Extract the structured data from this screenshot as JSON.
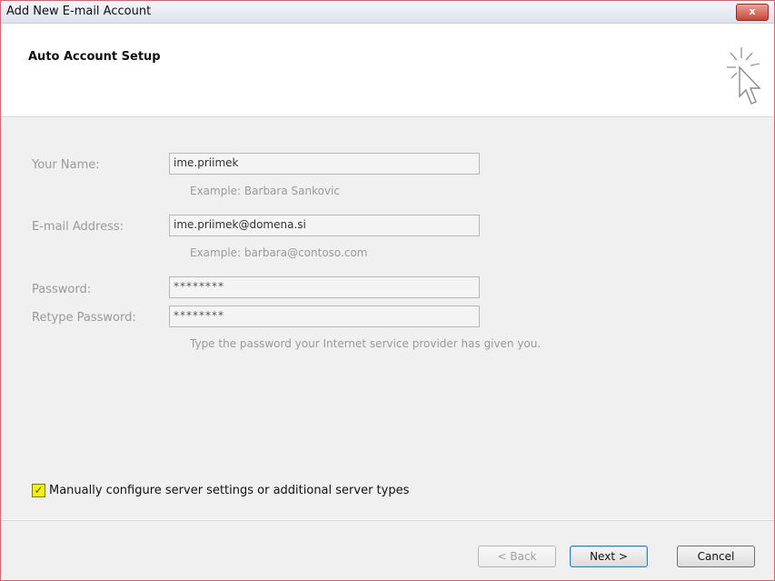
{
  "window": {
    "title": "Add New E-mail Account",
    "close_label": "x"
  },
  "header": {
    "title": "Auto Account Setup",
    "icon": "wizard-cursor-icon"
  },
  "form": {
    "name": {
      "label": "Your Name:",
      "value": "ime.priimek",
      "example": "Example: Barbara Sankovic"
    },
    "email": {
      "label": "E-mail Address:",
      "value": "ime.priimek@domena.si",
      "example": "Example: barbara@contoso.com"
    },
    "password": {
      "label": "Password:",
      "value": "********"
    },
    "retype_password": {
      "label": "Retype Password:",
      "value": "********"
    },
    "password_hint": "Type the password your Internet service provider has given you."
  },
  "manual_config": {
    "label": "Manually configure server settings or additional server types",
    "checked": true,
    "check_glyph": "✓",
    "highlight_color": "#fff200"
  },
  "buttons": {
    "back": "< Back",
    "next": "Next >",
    "cancel": "Cancel"
  }
}
